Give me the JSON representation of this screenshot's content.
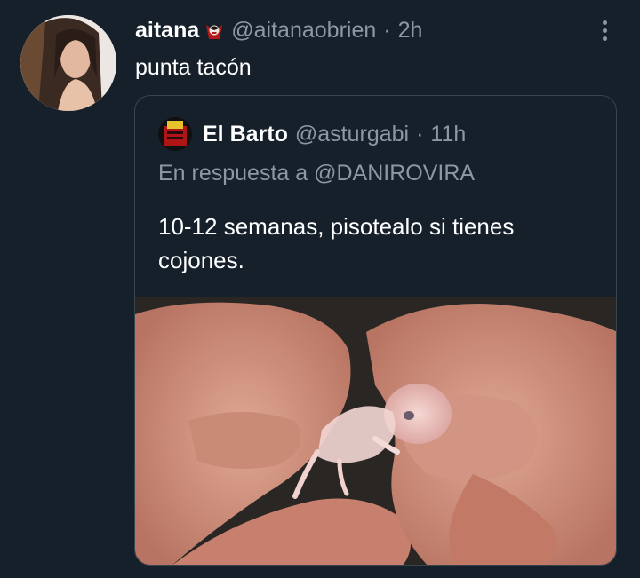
{
  "tweet": {
    "display_name": "aitana",
    "handle": "@aitanaobrien",
    "separator": "·",
    "time": "2h",
    "text": "punta tacón",
    "avatar_icon": "user-avatar",
    "badge_icon": "vampire-emoji-icon",
    "more_icon": "more-options-icon"
  },
  "quoted": {
    "display_name": "El Barto",
    "handle": "@asturgabi",
    "separator": "·",
    "time": "11h",
    "reply_prefix": "En respuesta a",
    "reply_to": "@DANIROVIRA",
    "text": "10-12 semanas, pisotealo si tienes cojones.",
    "avatar_icon": "el-barto-avatar",
    "media_icon": "photo-hands-holding-fetus"
  },
  "colors": {
    "background": "#15202b",
    "secondary_text": "#8b98a5",
    "border": "#38444d"
  }
}
